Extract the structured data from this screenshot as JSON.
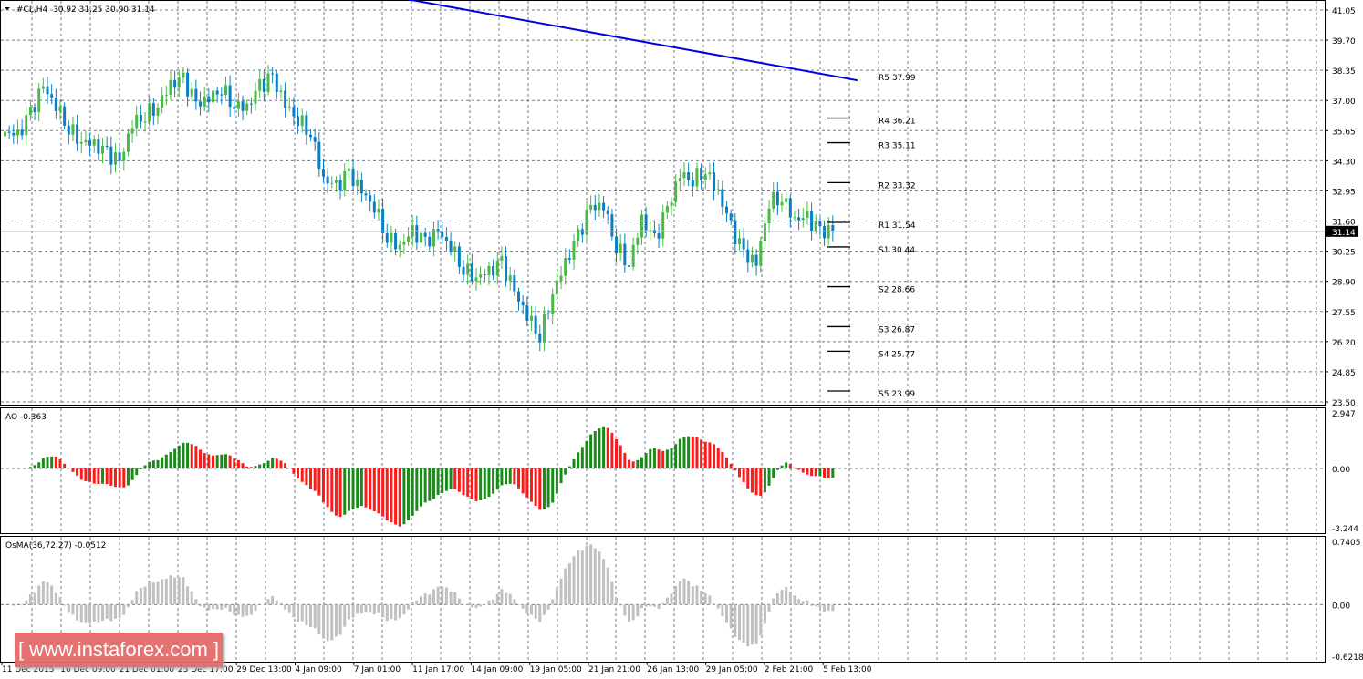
{
  "header": {
    "symbol": "#CL,H4",
    "ohlc": "30.92 31.25 30.90 31.14"
  },
  "watermark": "[ www.instaforex.com ]",
  "colors": {
    "bull": "#4cb848",
    "bear": "#0a7fc4",
    "ao_up": "#1a8a1a",
    "ao_down": "#ff1a1a",
    "osma": "#c0c0c0",
    "trend": "#0000e0",
    "grid": "#6d7b8d"
  },
  "chart_data": [
    {
      "type": "candlestick",
      "title": "#CL,H4",
      "price_axis": {
        "ticks": [
          "41.05",
          "39.70",
          "38.35",
          "37.00",
          "35.65",
          "34.30",
          "32.95",
          "31.60",
          "30.25",
          "28.90",
          "27.55",
          "26.20",
          "24.85",
          "23.50"
        ],
        "range": [
          23.5,
          41.05
        ]
      },
      "current_price": "31.14",
      "closes": [
        35.6,
        35.4,
        36.4,
        37.6,
        36.8,
        35.8,
        35.2,
        35.0,
        34.6,
        34.2,
        36.0,
        36.4,
        36.8,
        37.7,
        37.9,
        36.8,
        37.1,
        37.6,
        36.8,
        36.7,
        37.6,
        38.0,
        36.8,
        36.2,
        35.6,
        33.5,
        33.1,
        33.7,
        32.9,
        32.3,
        30.9,
        30.5,
        31.1,
        30.6,
        31.1,
        30.5,
        29.5,
        29.1,
        29.3,
        29.7,
        28.4,
        27.4,
        26.5,
        28.4,
        29.7,
        30.9,
        32.2,
        32.3,
        30.5,
        29.7,
        31.7,
        30.7,
        32.1,
        33.7,
        33.5,
        33.9,
        32.9,
        31.3,
        30.1,
        29.7,
        32.5,
        32.7,
        31.7,
        31.7,
        31.1,
        31.14
      ],
      "time_labels": [
        "11 Dec 2015",
        "16 Dec 09:00",
        "21 Dec 01:00",
        "23 Dec 17:00",
        "29 Dec 13:00",
        "4 Jan 09:00",
        "7 Jan 01:00",
        "11 Jan 17:00",
        "14 Jan 09:00",
        "19 Jan 05:00",
        "21 Jan 21:00",
        "26 Jan 13:00",
        "29 Jan 05:00",
        "2 Feb 21:00",
        "5 Feb 13:00"
      ],
      "pivots": [
        {
          "label": "R5 37.99",
          "value": 37.99
        },
        {
          "label": "R4 36.21",
          "value": 36.21
        },
        {
          "label": "R3 35.11",
          "value": 35.11
        },
        {
          "label": "R2 33.32",
          "value": 33.32
        },
        {
          "label": "R1 31.54",
          "value": 31.54
        },
        {
          "label": "S1 30.44",
          "value": 30.44
        },
        {
          "label": "S2 28.66",
          "value": 28.66
        },
        {
          "label": "S3 26.87",
          "value": 26.87
        },
        {
          "label": "S4 25.77",
          "value": 25.77
        },
        {
          "label": "S5 23.99",
          "value": 23.99
        }
      ],
      "trendline": {
        "from": 42.0,
        "to": 37.9
      }
    },
    {
      "type": "bar",
      "title": "AO -0.363",
      "ticks": [
        "2.947",
        "0.00",
        "-3.244"
      ],
      "range": [
        -3.244,
        2.947
      ]
    },
    {
      "type": "bar",
      "title": "OsMA(36,72,27) -0.0512",
      "ticks": [
        "0.7405",
        "0.00",
        "-0.6218"
      ],
      "range": [
        -0.6218,
        0.7405
      ]
    }
  ]
}
